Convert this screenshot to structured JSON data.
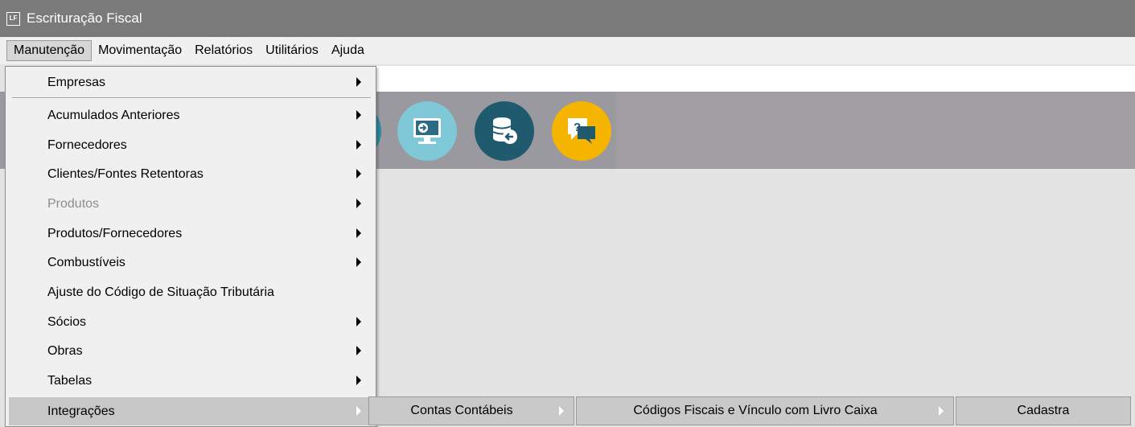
{
  "window": {
    "app_icon": "LF",
    "title": "Escrituração Fiscal"
  },
  "menubar": {
    "items": [
      {
        "label": "Manutenção",
        "active": true
      },
      {
        "label": "Movimentação"
      },
      {
        "label": "Relatórios"
      },
      {
        "label": "Utilitários"
      },
      {
        "label": "Ajuda"
      }
    ]
  },
  "toolbar": {
    "buttons": [
      {
        "icon": "monitor-import-icon",
        "color": "#7ec8d8"
      },
      {
        "icon": "database-export-icon",
        "color": "#1f5a6e"
      },
      {
        "icon": "help-chat-icon",
        "color": "#f4b400"
      }
    ]
  },
  "manutencao_menu": {
    "items": [
      {
        "label": "Empresas",
        "submenu": true
      },
      {
        "label": "Acumulados Anteriores",
        "submenu": true
      },
      {
        "label": "Fornecedores",
        "submenu": true
      },
      {
        "label": "Clientes/Fontes Retentoras",
        "submenu": true
      },
      {
        "label": "Produtos",
        "submenu": true,
        "disabled": true
      },
      {
        "label": "Produtos/Fornecedores",
        "submenu": true
      },
      {
        "label": "Combustíveis",
        "submenu": true
      },
      {
        "label": "Ajuste do Código de Situação Tributária",
        "submenu": false
      },
      {
        "label": "Sócios",
        "submenu": true
      },
      {
        "label": "Obras",
        "submenu": true
      },
      {
        "label": "Tabelas",
        "submenu": true
      },
      {
        "label": "Integrações",
        "submenu": true,
        "highlighted": true
      }
    ]
  },
  "submenus": {
    "integracoes": "Contas Contábeis",
    "contas_contabeis": "Códigos Fiscais e Vínculo com Livro Caixa",
    "codigos_fiscais": "Cadastra"
  }
}
